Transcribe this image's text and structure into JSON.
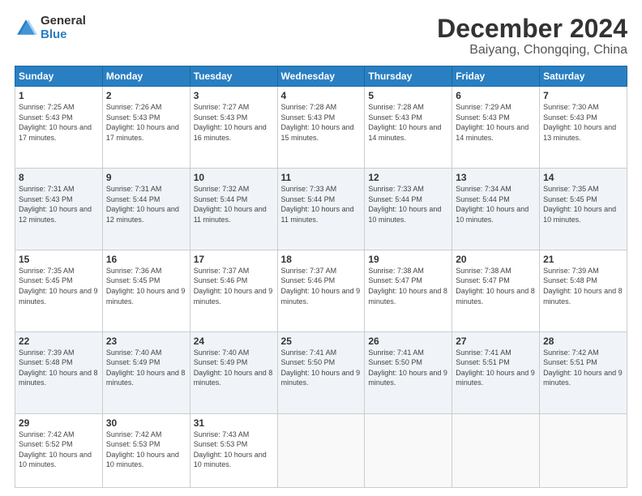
{
  "header": {
    "logo_general": "General",
    "logo_blue": "Blue",
    "main_title": "December 2024",
    "subtitle": "Baiyang, Chongqing, China"
  },
  "calendar": {
    "columns": [
      "Sunday",
      "Monday",
      "Tuesday",
      "Wednesday",
      "Thursday",
      "Friday",
      "Saturday"
    ],
    "weeks": [
      [
        {
          "day": "1",
          "sunrise": "7:25 AM",
          "sunset": "5:43 PM",
          "daylight": "10 hours and 17 minutes."
        },
        {
          "day": "2",
          "sunrise": "7:26 AM",
          "sunset": "5:43 PM",
          "daylight": "10 hours and 17 minutes."
        },
        {
          "day": "3",
          "sunrise": "7:27 AM",
          "sunset": "5:43 PM",
          "daylight": "10 hours and 16 minutes."
        },
        {
          "day": "4",
          "sunrise": "7:28 AM",
          "sunset": "5:43 PM",
          "daylight": "10 hours and 15 minutes."
        },
        {
          "day": "5",
          "sunrise": "7:28 AM",
          "sunset": "5:43 PM",
          "daylight": "10 hours and 14 minutes."
        },
        {
          "day": "6",
          "sunrise": "7:29 AM",
          "sunset": "5:43 PM",
          "daylight": "10 hours and 14 minutes."
        },
        {
          "day": "7",
          "sunrise": "7:30 AM",
          "sunset": "5:43 PM",
          "daylight": "10 hours and 13 minutes."
        }
      ],
      [
        {
          "day": "8",
          "sunrise": "7:31 AM",
          "sunset": "5:43 PM",
          "daylight": "10 hours and 12 minutes."
        },
        {
          "day": "9",
          "sunrise": "7:31 AM",
          "sunset": "5:44 PM",
          "daylight": "10 hours and 12 minutes."
        },
        {
          "day": "10",
          "sunrise": "7:32 AM",
          "sunset": "5:44 PM",
          "daylight": "10 hours and 11 minutes."
        },
        {
          "day": "11",
          "sunrise": "7:33 AM",
          "sunset": "5:44 PM",
          "daylight": "10 hours and 11 minutes."
        },
        {
          "day": "12",
          "sunrise": "7:33 AM",
          "sunset": "5:44 PM",
          "daylight": "10 hours and 10 minutes."
        },
        {
          "day": "13",
          "sunrise": "7:34 AM",
          "sunset": "5:44 PM",
          "daylight": "10 hours and 10 minutes."
        },
        {
          "day": "14",
          "sunrise": "7:35 AM",
          "sunset": "5:45 PM",
          "daylight": "10 hours and 10 minutes."
        }
      ],
      [
        {
          "day": "15",
          "sunrise": "7:35 AM",
          "sunset": "5:45 PM",
          "daylight": "10 hours and 9 minutes."
        },
        {
          "day": "16",
          "sunrise": "7:36 AM",
          "sunset": "5:45 PM",
          "daylight": "10 hours and 9 minutes."
        },
        {
          "day": "17",
          "sunrise": "7:37 AM",
          "sunset": "5:46 PM",
          "daylight": "10 hours and 9 minutes."
        },
        {
          "day": "18",
          "sunrise": "7:37 AM",
          "sunset": "5:46 PM",
          "daylight": "10 hours and 9 minutes."
        },
        {
          "day": "19",
          "sunrise": "7:38 AM",
          "sunset": "5:47 PM",
          "daylight": "10 hours and 8 minutes."
        },
        {
          "day": "20",
          "sunrise": "7:38 AM",
          "sunset": "5:47 PM",
          "daylight": "10 hours and 8 minutes."
        },
        {
          "day": "21",
          "sunrise": "7:39 AM",
          "sunset": "5:48 PM",
          "daylight": "10 hours and 8 minutes."
        }
      ],
      [
        {
          "day": "22",
          "sunrise": "7:39 AM",
          "sunset": "5:48 PM",
          "daylight": "10 hours and 8 minutes."
        },
        {
          "day": "23",
          "sunrise": "7:40 AM",
          "sunset": "5:49 PM",
          "daylight": "10 hours and 8 minutes."
        },
        {
          "day": "24",
          "sunrise": "7:40 AM",
          "sunset": "5:49 PM",
          "daylight": "10 hours and 8 minutes."
        },
        {
          "day": "25",
          "sunrise": "7:41 AM",
          "sunset": "5:50 PM",
          "daylight": "10 hours and 9 minutes."
        },
        {
          "day": "26",
          "sunrise": "7:41 AM",
          "sunset": "5:50 PM",
          "daylight": "10 hours and 9 minutes."
        },
        {
          "day": "27",
          "sunrise": "7:41 AM",
          "sunset": "5:51 PM",
          "daylight": "10 hours and 9 minutes."
        },
        {
          "day": "28",
          "sunrise": "7:42 AM",
          "sunset": "5:51 PM",
          "daylight": "10 hours and 9 minutes."
        }
      ],
      [
        {
          "day": "29",
          "sunrise": "7:42 AM",
          "sunset": "5:52 PM",
          "daylight": "10 hours and 10 minutes."
        },
        {
          "day": "30",
          "sunrise": "7:42 AM",
          "sunset": "5:53 PM",
          "daylight": "10 hours and 10 minutes."
        },
        {
          "day": "31",
          "sunrise": "7:43 AM",
          "sunset": "5:53 PM",
          "daylight": "10 hours and 10 minutes."
        },
        null,
        null,
        null,
        null
      ]
    ]
  }
}
